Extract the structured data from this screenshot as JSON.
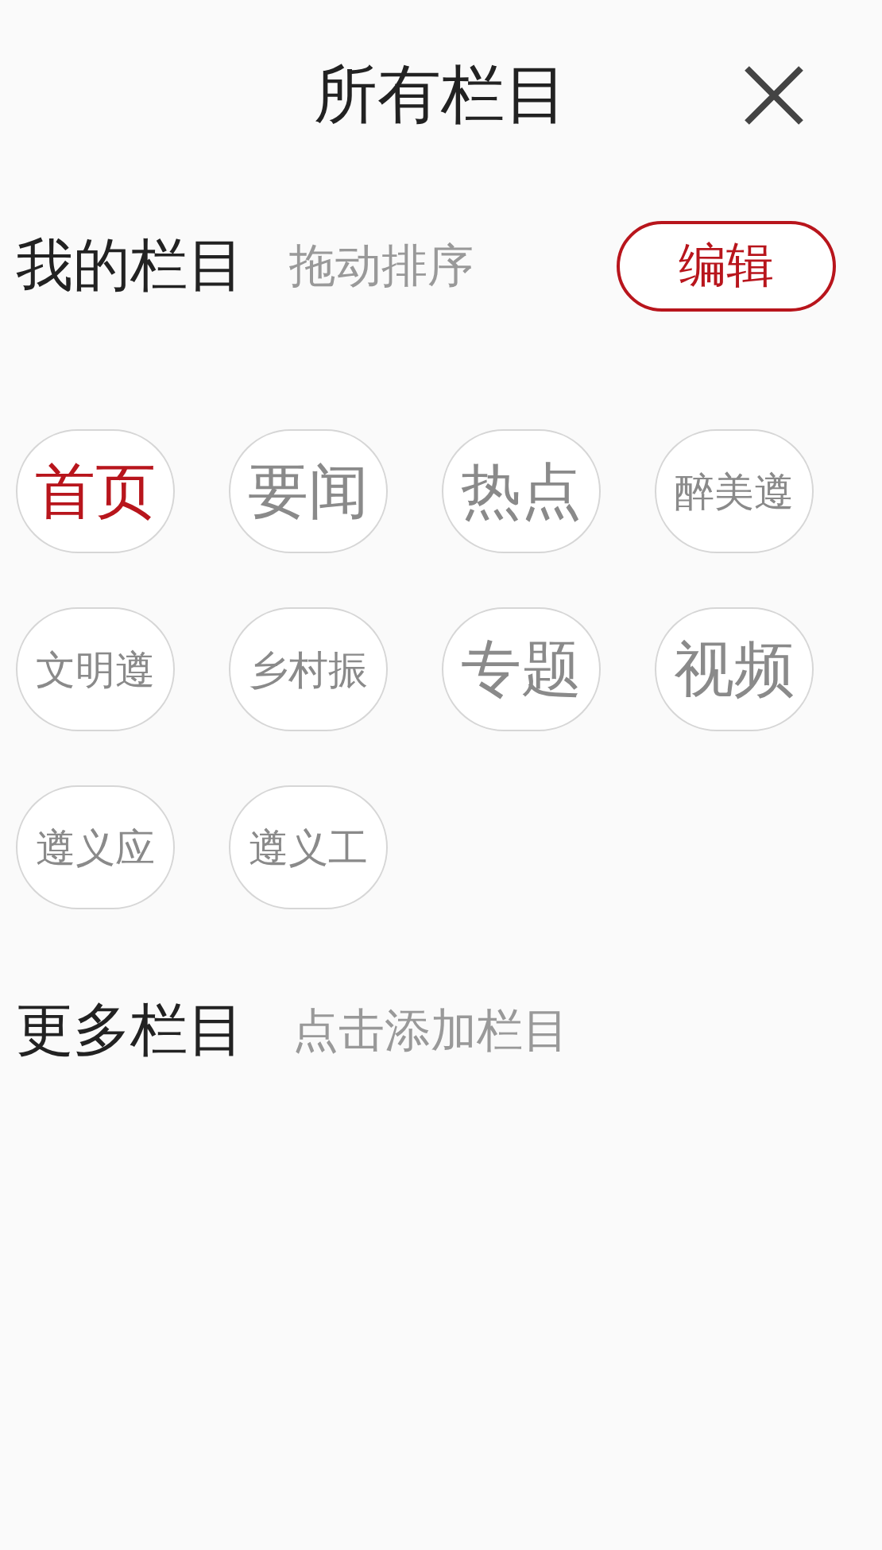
{
  "header": {
    "title": "所有栏目"
  },
  "my_channels": {
    "title": "我的栏目",
    "hint": "拖动排序",
    "edit_button": "编辑",
    "items": [
      {
        "label": "首页",
        "selected": true
      },
      {
        "label": "要闻",
        "selected": false
      },
      {
        "label": "热点",
        "selected": false
      },
      {
        "label": "醉美遵",
        "selected": false
      },
      {
        "label": "文明遵",
        "selected": false
      },
      {
        "label": "乡村振",
        "selected": false
      },
      {
        "label": "专题",
        "selected": false
      },
      {
        "label": "视频",
        "selected": false
      },
      {
        "label": "遵义应",
        "selected": false
      },
      {
        "label": "遵义工",
        "selected": false
      }
    ]
  },
  "more_channels": {
    "title": "更多栏目",
    "hint": "点击添加栏目"
  }
}
